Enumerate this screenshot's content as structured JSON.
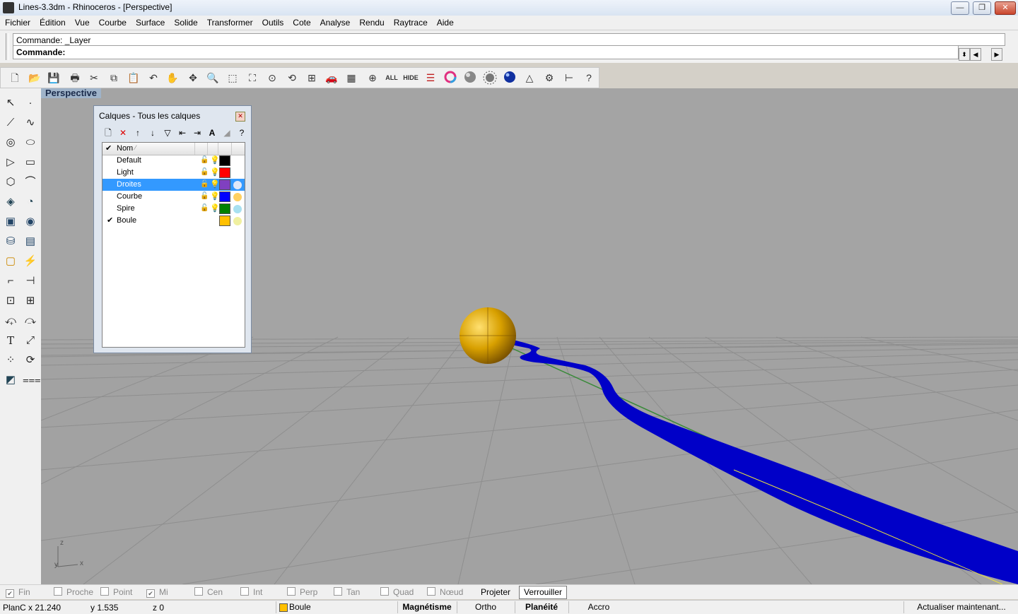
{
  "window": {
    "title": "Lines-3.3dm - Rhinoceros - [Perspective]",
    "controls": {
      "minimize": "—",
      "restore": "❐",
      "close": "✕"
    }
  },
  "menu": [
    "Fichier",
    "Édition",
    "Vue",
    "Courbe",
    "Surface",
    "Solide",
    "Transformer",
    "Outils",
    "Cote",
    "Analyse",
    "Rendu",
    "Raytrace",
    "Aide"
  ],
  "command": {
    "history": "Commande: _Layer",
    "prompt": "Commande:"
  },
  "top_toolbar_icons": [
    "new-file",
    "open-file",
    "save",
    "print",
    "cut",
    "copy",
    "paste",
    "undo",
    "pan",
    "rotate-view",
    "zoom",
    "zoom-window",
    "zoom-extents",
    "zoom-selected",
    "undo-view",
    "four-viewports",
    "car-render",
    "layer-manager",
    "object-snap",
    "ALL",
    "HIDE",
    "layers-stack",
    "color-wheel",
    "render-shaded",
    "render-preview",
    "render-blue",
    "light-cone",
    "options-gear",
    "dimension",
    "help"
  ],
  "toolbar_text": {
    "all": "ALL",
    "hide": "HIDE"
  },
  "viewport": {
    "label": "Perspective",
    "axes": {
      "z": "z",
      "y": "y",
      "x": "x"
    },
    "sphere_color": "#d8a000",
    "pipe_color": "#0000c8",
    "background": "#a4a4a4"
  },
  "layers_panel": {
    "title": "Calques - Tous les calques",
    "close": "✕",
    "header": {
      "check": "✔",
      "name": "Nom",
      "sort": "⁄"
    },
    "tools": [
      "new-layer",
      "delete-layer",
      "move-up",
      "move-down",
      "filter",
      "import",
      "export",
      "text",
      "triangle",
      "help"
    ],
    "tool_glyphs": {
      "new": "🗋",
      "delete": "✕",
      "up": "↑",
      "down": "↓",
      "filter": "▽",
      "import": "⇤",
      "export": "⇥",
      "text": "A",
      "triangle": "◢",
      "help": "?"
    },
    "rows": [
      {
        "name": "Default",
        "current": "",
        "lock": "🔓",
        "bulb": "💡",
        "color": "#000000",
        "material": ""
      },
      {
        "name": "Light",
        "current": "",
        "lock": "🔓",
        "bulb": "💡",
        "color": "#ff0000",
        "material": ""
      },
      {
        "name": "Droites",
        "current": "",
        "lock": "🔓",
        "bulb": "💡",
        "color": "#8040c0",
        "material": "#e0e8f8"
      },
      {
        "name": "Courbe",
        "current": "",
        "lock": "🔓",
        "bulb": "💡",
        "color": "#0000ff",
        "material": "#ffd060"
      },
      {
        "name": "Spire",
        "current": "",
        "lock": "🔓",
        "bulb": "💡",
        "color": "#008000",
        "material": "#a8e0f0"
      },
      {
        "name": "Boule",
        "current": "✔",
        "lock": "",
        "bulb": "",
        "color": "#ffc000",
        "material": "#f0f0a0"
      }
    ],
    "selected": "Droites"
  },
  "osnaps": [
    {
      "label": "Fin",
      "checked": "✔"
    },
    {
      "label": "Proche",
      "checked": ""
    },
    {
      "label": "Point",
      "checked": ""
    },
    {
      "label": "Mi",
      "checked": "✔"
    },
    {
      "label": "Cen",
      "checked": ""
    },
    {
      "label": "Int",
      "checked": ""
    },
    {
      "label": "Perp",
      "checked": ""
    },
    {
      "label": "Tan",
      "checked": ""
    },
    {
      "label": "Quad",
      "checked": ""
    },
    {
      "label": "Nœud",
      "checked": ""
    }
  ],
  "osnap_buttons": {
    "projeter": "Projeter",
    "verrouiller": "Verrouiller"
  },
  "status": {
    "plan": "PlanC",
    "x": "x 21.240",
    "y": "y 1.535",
    "z": "z 0",
    "layer": "Boule",
    "layer_color": "#ffc000",
    "magnetisme": "Magnétisme",
    "ortho": "Ortho",
    "planeite": "Planéité",
    "accro": "Accro",
    "update": "Actualiser maintenant..."
  }
}
